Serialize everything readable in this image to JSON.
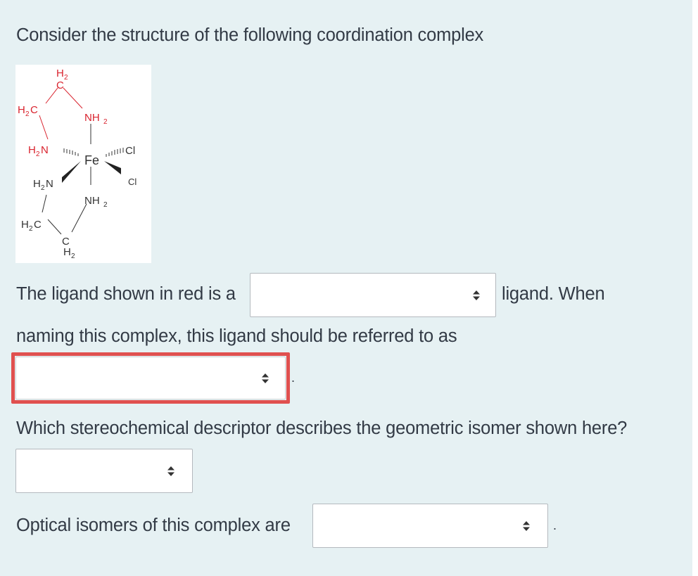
{
  "question": {
    "intro": "Consider the structure of the following coordination complex",
    "sentence1_before": "The ligand shown in red is a",
    "sentence1_after": "ligand. When",
    "sentence2": "naming this complex, this ligand should be referred to as",
    "period1": ".",
    "question2": "Which stereochemical descriptor describes the geometric isomer shown here?",
    "question3_before": "Optical isomers of this complex are",
    "period3": "."
  },
  "dropdowns": {
    "ligand_type": {
      "value": ""
    },
    "ligand_name": {
      "value": ""
    },
    "stereo_descriptor": {
      "value": ""
    },
    "optical_isomers": {
      "value": ""
    }
  },
  "structure": {
    "metal": "Fe",
    "labels": {
      "ch2_top_H": "H",
      "ch2_top_sub": "2",
      "ch2_top_C": "C",
      "h2c_upper_H": "H",
      "h2c_upper_sub": "2",
      "h2c_upper_C": "C",
      "nh2_upper_N": "NH",
      "nh2_upper_sub": "2",
      "h2n_red_H": "H",
      "h2n_red_sub": "2",
      "h2n_red_N": "N",
      "cl_top": "Cl",
      "cl_bottom": "Cl",
      "h2n_lower_H": "H",
      "h2n_lower_sub": "2",
      "h2n_lower_N": "N",
      "nh2_lower_N": "NH",
      "nh2_lower_sub": "2",
      "h2c_lower_H": "H",
      "h2c_lower_sub": "2",
      "h2c_lower_C": "C",
      "ch2_bottom_C": "C",
      "ch2_bottom_H": "H",
      "ch2_bottom_sub": "2"
    }
  },
  "colors": {
    "panel_bg": "#e6f1f3",
    "highlight_border": "#e0504f",
    "ligand_red": "#d9232e",
    "text": "#323a45"
  }
}
